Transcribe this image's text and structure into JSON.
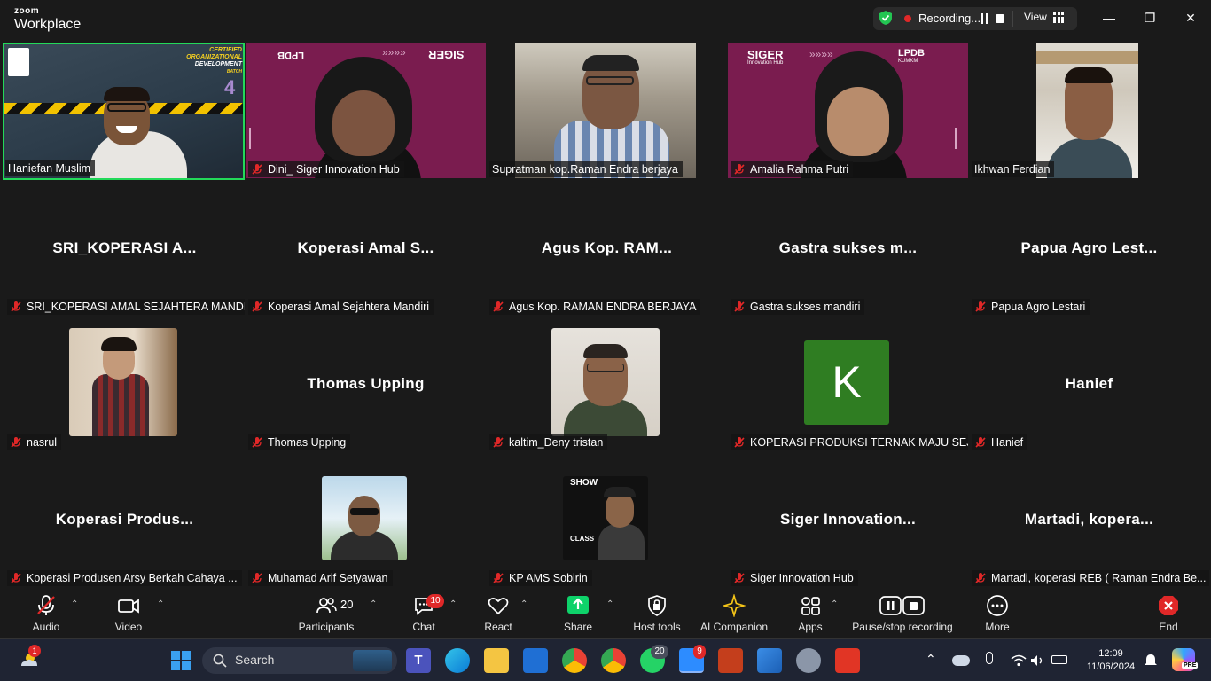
{
  "app": {
    "brand_top": "zoom",
    "brand_bottom": "Workplace"
  },
  "titlebar": {
    "recording_label": "Recording...",
    "view_label": "View",
    "minimize": "—",
    "maximize": "❐",
    "close": "✕"
  },
  "tiles": [
    {
      "name": "Haniefan Muslim",
      "muted": false,
      "active": true
    },
    {
      "name": "Dini_ Siger Innovation Hub",
      "muted": true
    },
    {
      "name": "Supratman kop.Raman Endra berjaya",
      "muted": false
    },
    {
      "name": "Amalia Rahma Putri",
      "muted": true
    },
    {
      "name": "Ikhwan Ferdian",
      "muted": false
    },
    {
      "name": "SRI_KOPERASI AMAL SEJAHTERA MANDIRI",
      "big": "SRI_KOPERASI  A...",
      "muted": true
    },
    {
      "name": "Koperasi Amal Sejahtera Mandiri",
      "big": "Koperasi Amal S...",
      "muted": true
    },
    {
      "name": "Agus Kop. RAMAN ENDRA BERJAYA",
      "big": "Agus Kop. RAM...",
      "muted": true
    },
    {
      "name": "Gastra sukses mandiri",
      "big": "Gastra sukses m...",
      "muted": true
    },
    {
      "name": "Papua Agro Lestari",
      "big": "Papua Agro Lest...",
      "muted": true
    },
    {
      "name": "nasrul",
      "muted": true
    },
    {
      "name": "Thomas Upping",
      "big": "Thomas Upping",
      "muted": true
    },
    {
      "name": "kaltim_Deny tristan",
      "muted": true
    },
    {
      "name": "KOPERASI PRODUKSI TERNAK MAJU SEJ...",
      "avatar_letter": "K",
      "muted": true
    },
    {
      "name": "Hanief",
      "big": "Hanief",
      "muted": true
    },
    {
      "name": "Koperasi Produsen Arsy Berkah Cahaya ...",
      "big": "Koperasi  Produs...",
      "muted": true
    },
    {
      "name": "Muhamad Arif Setyawan",
      "muted": true
    },
    {
      "name": "KP AMS Sobirin",
      "muted": true
    },
    {
      "name": "Siger Innovation Hub",
      "big": "Siger  Innovation...",
      "muted": true
    },
    {
      "name": "Martadi, koperasi REB ( Raman Endra Be...",
      "big": "Martadi,  kopera...",
      "muted": true
    }
  ],
  "video_text": {
    "certified_line1": "CERTIFIED",
    "certified_line2": "ORGANIZATIONAL",
    "certified_line3": "DEVELOPMENT",
    "batch": "BATCH",
    "batch_no": "4",
    "lpdb": "LPDB",
    "kumkm": "KUMKM",
    "siger": "SIGER",
    "innovation_hub": "Innovation Hub",
    "show": "SHOW",
    "class": "CLASS"
  },
  "toolbar": {
    "audio": "Audio",
    "video": "Video",
    "participants": "Participants",
    "participants_count": "20",
    "chat": "Chat",
    "chat_badge": "10",
    "react": "React",
    "share": "Share",
    "host_tools": "Host tools",
    "ai_companion": "AI Companion",
    "apps": "Apps",
    "pause_stop_recording": "Pause/stop recording",
    "more": "More",
    "end": "End"
  },
  "taskbar": {
    "search_label": "Search",
    "weather_badge": "1",
    "whatsapp_badge": "20",
    "zoom_badge": "9",
    "time": "12:09",
    "date": "11/06/2024",
    "copilot_tag": "PRE"
  },
  "colors": {
    "background": "#1a1a1a",
    "active_speaker": "#23d959",
    "mute_red": "#e02828",
    "siger_purple": "#7a1c4f",
    "share_green": "#0ed26a",
    "avatar_green": "#2f7d22",
    "taskbar": "#1f2433"
  }
}
